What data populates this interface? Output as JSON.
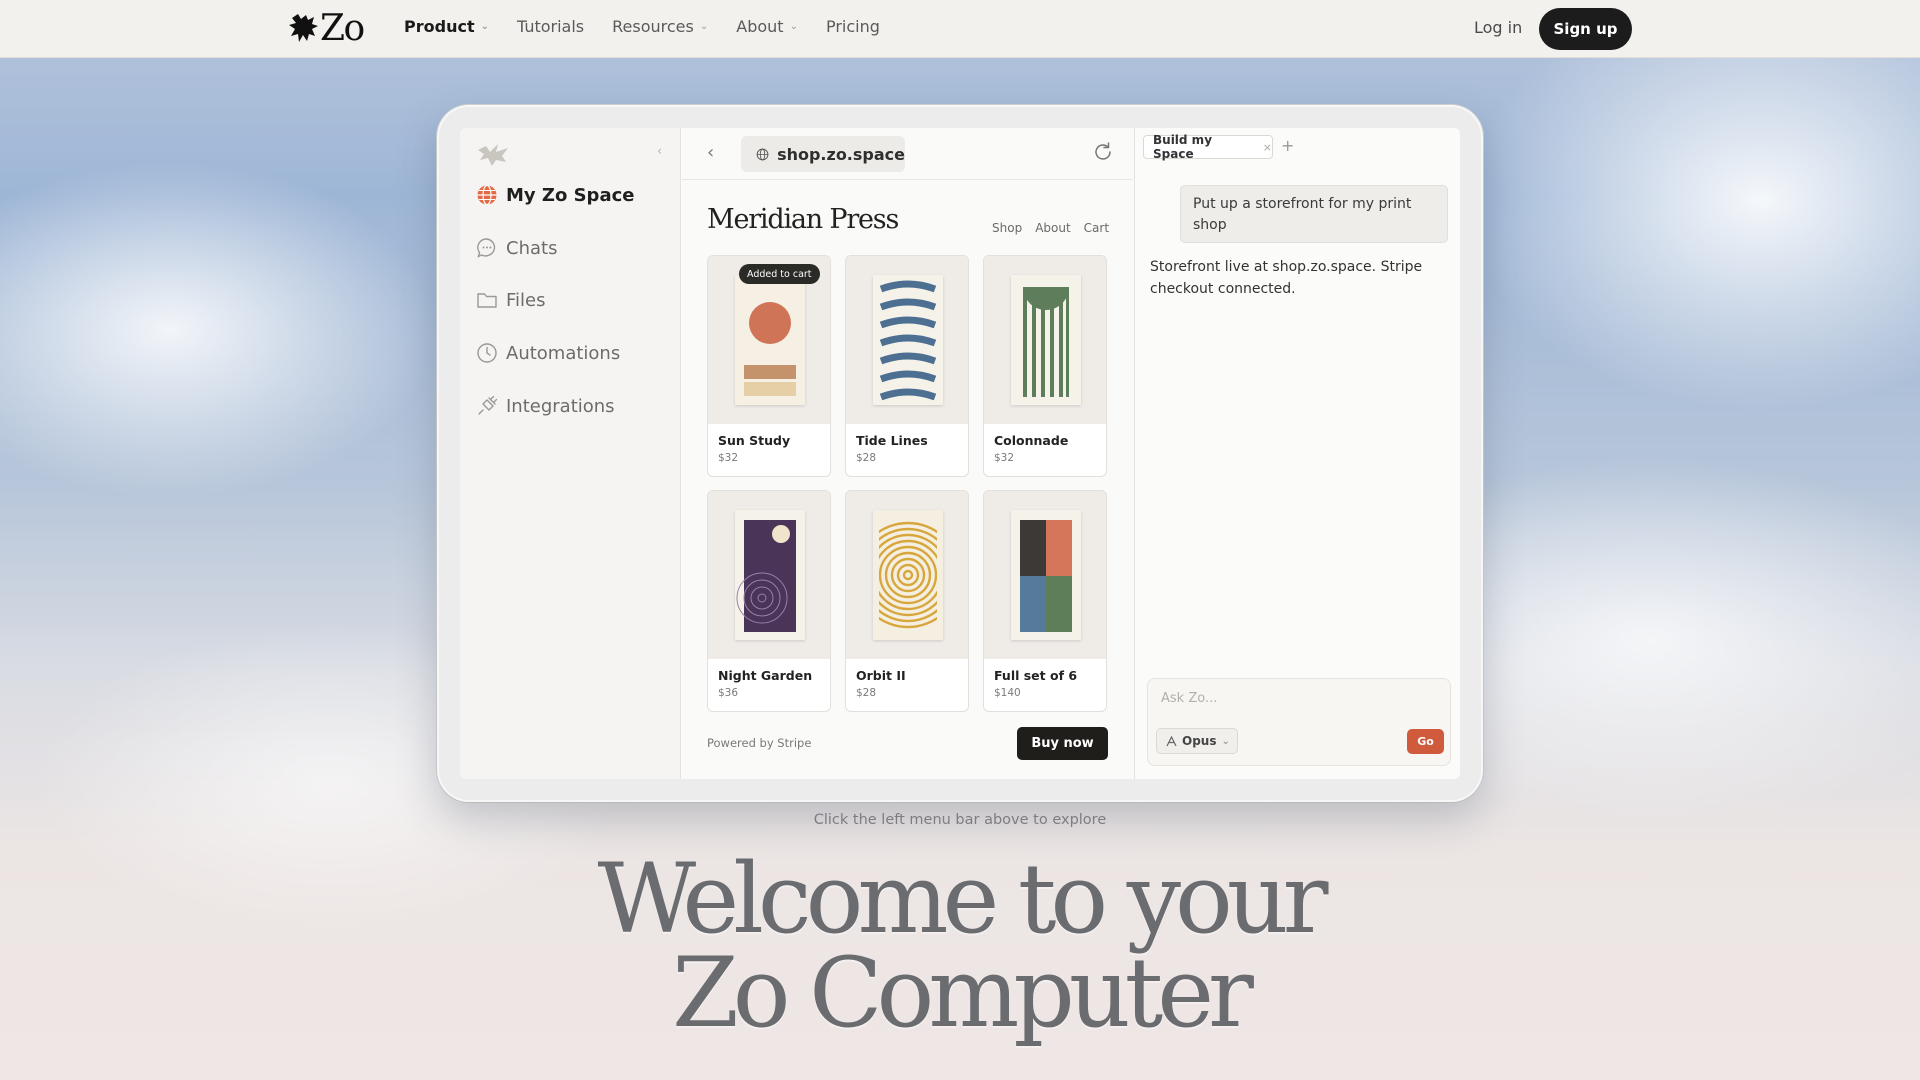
{
  "nav": {
    "logo_text": "Zo",
    "links": [
      {
        "label": "Product",
        "dropdown": true,
        "active": true
      },
      {
        "label": "Tutorials",
        "dropdown": false
      },
      {
        "label": "Resources",
        "dropdown": true
      },
      {
        "label": "About",
        "dropdown": true
      },
      {
        "label": "Pricing",
        "dropdown": false
      }
    ],
    "login": "Log in",
    "signup": "Sign up"
  },
  "sidebar": {
    "items": [
      {
        "label": "My Zo Space",
        "icon": "globe-icon",
        "active": true
      },
      {
        "label": "Chats",
        "icon": "chat-bubble-icon"
      },
      {
        "label": "Files",
        "icon": "folder-icon"
      },
      {
        "label": "Automations",
        "icon": "clock-icon"
      },
      {
        "label": "Integrations",
        "icon": "plug-icon"
      }
    ]
  },
  "browser": {
    "url": "shop.zo.space",
    "shop_title": "Meridian Press",
    "shop_nav": [
      "Shop",
      "About",
      "Cart"
    ],
    "products": [
      {
        "name": "Sun Study",
        "price": "$32",
        "badge": "Added to cart"
      },
      {
        "name": "Tide Lines",
        "price": "$28"
      },
      {
        "name": "Colonnade",
        "price": "$32"
      },
      {
        "name": "Night Garden",
        "price": "$36"
      },
      {
        "name": "Orbit II",
        "price": "$28"
      },
      {
        "name": "Full set of 6",
        "price": "$140"
      }
    ],
    "powered_by": "Powered by Stripe",
    "buy_now": "Buy now"
  },
  "chat": {
    "tab_label": "Build my Space",
    "user_message": "Put up a storefront for my print shop",
    "bot_message": "Storefront live at shop.zo.space. Stripe checkout connected.",
    "input_placeholder": "Ask Zo...",
    "model": "Opus",
    "send": "Go"
  },
  "hint": "Click the left menu bar above to explore",
  "hero": {
    "line1": "Welcome to your",
    "line2": "Zo Computer"
  },
  "colors": {
    "accent": "#cf5b3c",
    "dark": "#1c1c1c"
  }
}
